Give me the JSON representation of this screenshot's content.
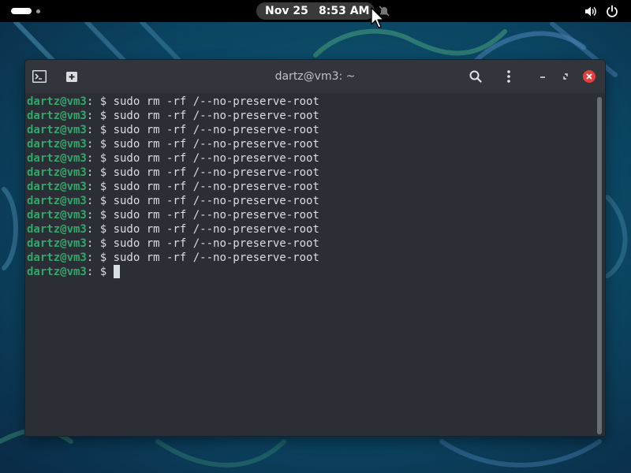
{
  "topbar": {
    "date": "Nov 25",
    "time": "8:53 AM",
    "icons": [
      "activities-indicator",
      "do-not-disturb-icon",
      "volume-icon",
      "power-icon"
    ]
  },
  "window": {
    "title": "dartz@vm3: ~",
    "icons": [
      "terminal-icon",
      "new-tab-icon",
      "search-icon",
      "menu-kebab-icon",
      "minimize-icon",
      "restore-icon",
      "close-icon"
    ],
    "prompt_user": "dartz@vm3",
    "prompt_suffix": ": $ ",
    "lines": [
      {
        "user": "dartz@vm3",
        "sep": ": $ ",
        "cmd": "sudo rm -rf /--no-preserve-root"
      },
      {
        "user": "dartz@vm3",
        "sep": ": $ ",
        "cmd": "sudo rm -rf /--no-preserve-root"
      },
      {
        "user": "dartz@vm3",
        "sep": ": $ ",
        "cmd": "sudo rm -rf /--no-preserve-root"
      },
      {
        "user": "dartz@vm3",
        "sep": ": $ ",
        "cmd": "sudo rm -rf /--no-preserve-root"
      },
      {
        "user": "dartz@vm3",
        "sep": ": $ ",
        "cmd": "sudo rm -rf /--no-preserve-root"
      },
      {
        "user": "dartz@vm3",
        "sep": ": $ ",
        "cmd": "sudo rm -rf /--no-preserve-root"
      },
      {
        "user": "dartz@vm3",
        "sep": ": $ ",
        "cmd": "sudo rm -rf /--no-preserve-root"
      },
      {
        "user": "dartz@vm3",
        "sep": ": $ ",
        "cmd": "sudo rm -rf /--no-preserve-root"
      },
      {
        "user": "dartz@vm3",
        "sep": ": $ ",
        "cmd": "sudo rm -rf /--no-preserve-root"
      },
      {
        "user": "dartz@vm3",
        "sep": ": $ ",
        "cmd": "sudo rm -rf /--no-preserve-root"
      },
      {
        "user": "dartz@vm3",
        "sep": ": $ ",
        "cmd": "sudo rm -rf /--no-preserve-root"
      },
      {
        "user": "dartz@vm3",
        "sep": ": $ ",
        "cmd": "sudo rm -rf /--no-preserve-root"
      },
      {
        "user": "dartz@vm3",
        "sep": ": $ ",
        "cmd": ""
      }
    ]
  },
  "colors": {
    "prompt_user": "#2fa86a",
    "terminal_bg": "#2c2e35",
    "titlebar_bg": "#32353c",
    "close_button": "#e0413e",
    "desktop_bg": "#0b3450"
  }
}
